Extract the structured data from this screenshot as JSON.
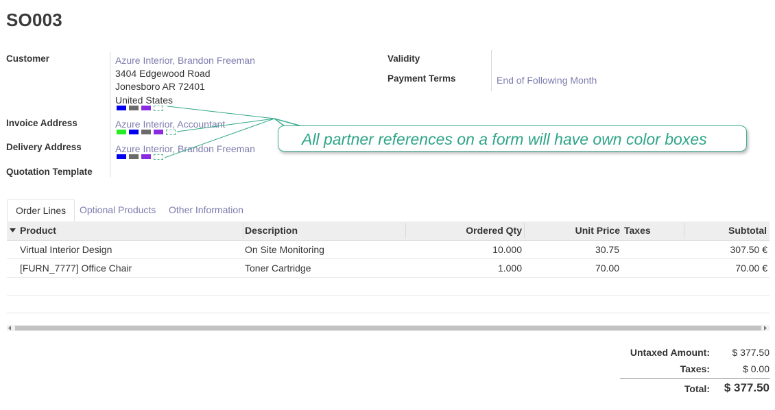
{
  "record": {
    "title": "SO003"
  },
  "customer": {
    "label": "Customer",
    "name": "Azure Interior, Brandon Freeman",
    "street": "3404 Edgewood Road",
    "city": "Jonesboro AR 72401",
    "country": "United States",
    "color_boxes": [
      "#0000ee",
      "#6b6b6b",
      "#8a2be2",
      "empty"
    ]
  },
  "invoice_address": {
    "label": "Invoice Address",
    "name": "Azure Interior, Accountant",
    "color_boxes": [
      "#22ee22",
      "#0000ee",
      "#6b6b6b",
      "#8a2be2",
      "empty"
    ]
  },
  "delivery_address": {
    "label": "Delivery Address",
    "name": "Azure Interior, Brandon Freeman",
    "color_boxes": [
      "#0000ee",
      "#6b6b6b",
      "#8a2be2",
      "empty"
    ]
  },
  "quotation_template": {
    "label": "Quotation Template"
  },
  "validity": {
    "label": "Validity"
  },
  "payment_terms": {
    "label": "Payment Terms",
    "value": "End of Following Month"
  },
  "callout": {
    "text": "All partner references on a form will have own color boxes"
  },
  "tabs": [
    {
      "label": "Order Lines"
    },
    {
      "label": "Optional Products"
    },
    {
      "label": "Other Information"
    }
  ],
  "order_lines": {
    "columns": {
      "product": "Product",
      "description": "Description",
      "qty": "Ordered Qty",
      "price": "Unit Price",
      "taxes": "Taxes",
      "subtotal": "Subtotal"
    },
    "rows": [
      {
        "product": "Virtual Interior Design",
        "description": "On Site Monitoring",
        "qty": "10.000",
        "price": "30.75",
        "taxes": "",
        "subtotal": "307.50 €"
      },
      {
        "product": "[FURN_7777] Office Chair",
        "description": "Toner Cartridge",
        "qty": "1.000",
        "price": "70.00",
        "taxes": "",
        "subtotal": "70.00 €"
      }
    ]
  },
  "totals": {
    "untaxed_label": "Untaxed Amount:",
    "untaxed_value": "$ 377.50",
    "taxes_label": "Taxes:",
    "taxes_value": "$ 0.00",
    "total_label": "Total:",
    "total_value": "$ 377.50"
  },
  "colors": {
    "link": "#7c7bad",
    "callout": "#2ea586"
  }
}
